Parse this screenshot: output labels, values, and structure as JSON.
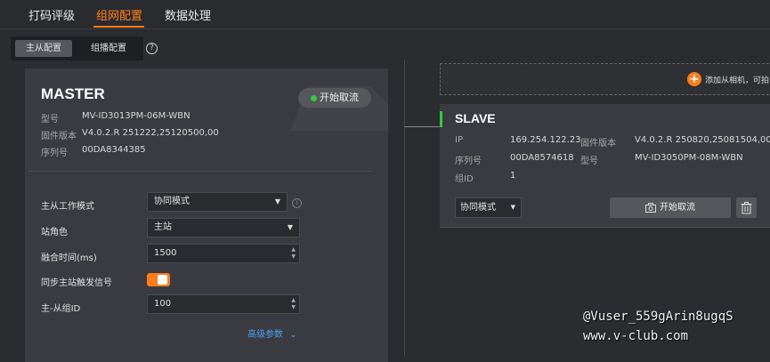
{
  "top_tabs": [
    {
      "label": "打码评级"
    },
    {
      "label": "组网配置"
    },
    {
      "label": "数据处理"
    }
  ],
  "sub_tabs": [
    {
      "label": "主从配置"
    },
    {
      "label": "组播配置"
    }
  ],
  "help_label": "?",
  "master": {
    "title": "MASTER",
    "start_button": "开始取流",
    "info": [
      {
        "key": "型号",
        "value": "MV-ID3013PM-06M-WBN"
      },
      {
        "key": "固件版本",
        "value": "V4.0.2.R 251222,25120500,00"
      },
      {
        "key": "序列号",
        "value": "00DA8344385"
      }
    ],
    "form": {
      "mode_label": "主从工作模式",
      "mode_value": "协同模式",
      "role_label": "站角色",
      "role_value": "主站",
      "fusion_label": "融合时间(ms)",
      "fusion_value": "1500",
      "sync_label": "同步主站触发信号",
      "group_label": "主-从组ID",
      "group_value": "100",
      "advanced_label": "高级参数"
    }
  },
  "add_slave_text": "添加从相机，可拍",
  "slave": {
    "title": "SLAVE",
    "ip_label": "IP",
    "ip_value": "169.254.122.23",
    "fw_label": "固件版本",
    "fw_value": "V4.0.2.R 250820,25081504,00",
    "sn_label": "序列号",
    "sn_value": "00DA8574618",
    "model_label": "型号",
    "model_value": "MV-ID3050PM-08M-WBN",
    "group_label": "组ID",
    "group_value": "1",
    "mode_value": "协同模式",
    "start_button": "开始取流"
  },
  "watermark": {
    "line1": "@Vuser_559gArin8ugqS",
    "line2": "www.v-club.com"
  },
  "colors": {
    "accent": "#ff7d1a",
    "active_dot": "#2ecc40",
    "link": "#4a9ff0"
  },
  "icons": {
    "help": "help-circle-icon",
    "plus": "plus-icon",
    "camera": "camera-refresh-icon",
    "delete": "trash-icon",
    "chevron": "chevron-down-icon"
  }
}
